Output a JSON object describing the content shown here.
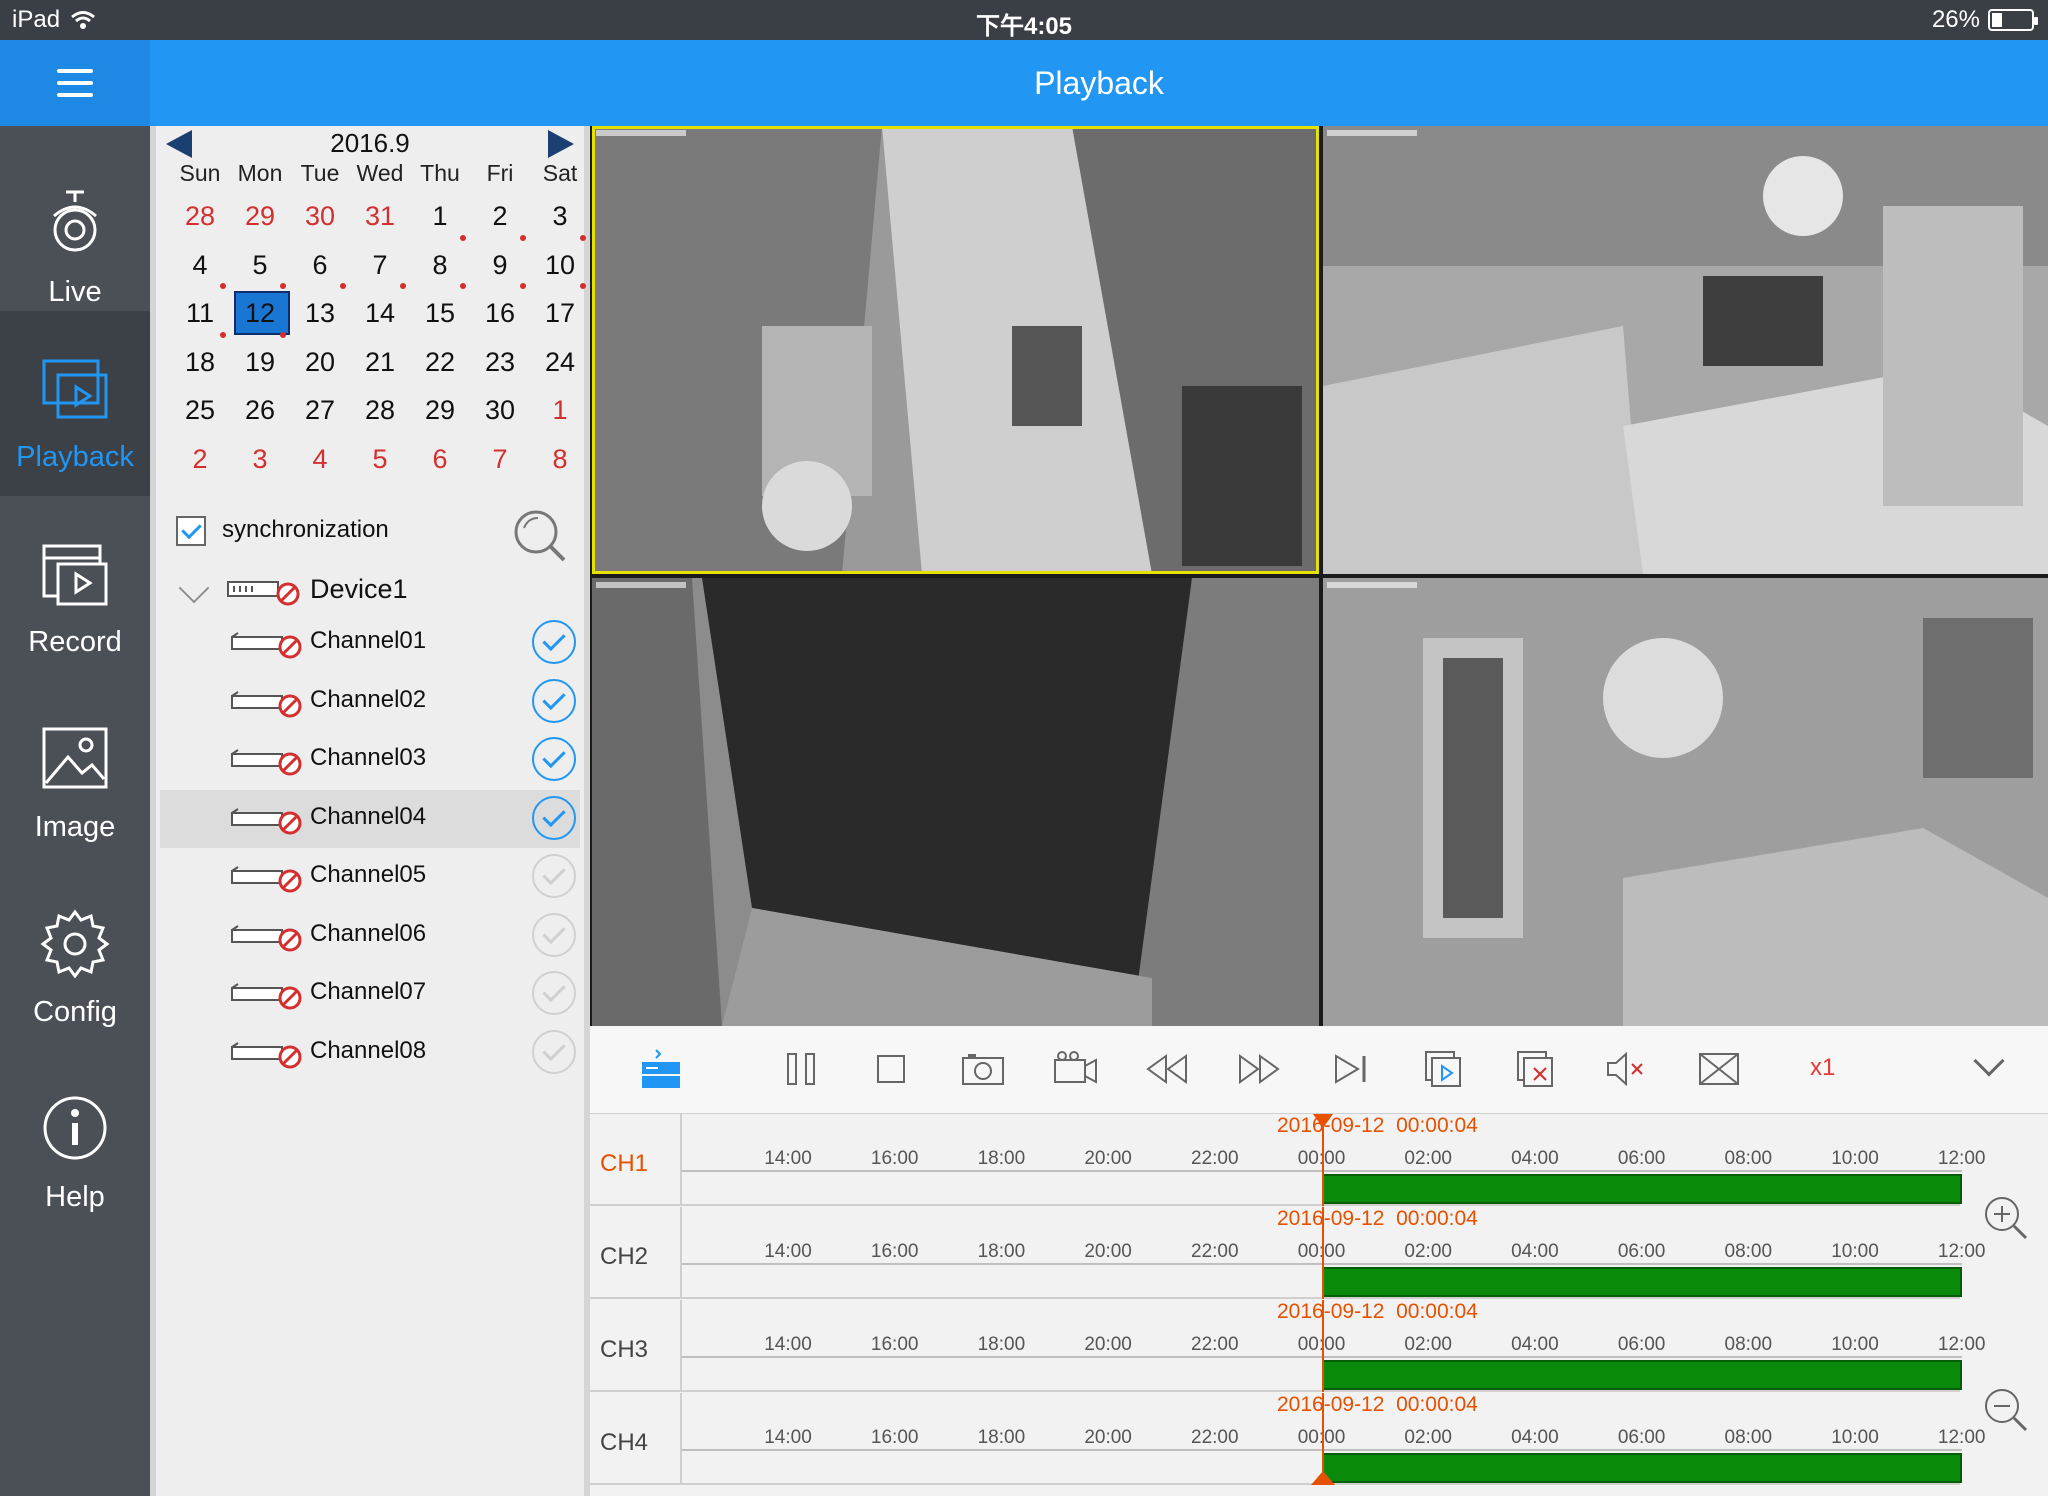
{
  "status_bar": {
    "device": "iPad",
    "time": "下午4:05",
    "battery": "26%",
    "battery_level": 0.26
  },
  "header": {
    "title": "Playback"
  },
  "nav": [
    {
      "label": "Live",
      "icon": "camera-icon",
      "active": false
    },
    {
      "label": "Playback",
      "icon": "playback-icon",
      "active": true
    },
    {
      "label": "Record",
      "icon": "record-icon",
      "active": false
    },
    {
      "label": "Image",
      "icon": "image-icon",
      "active": false
    },
    {
      "label": "Config",
      "icon": "gear-icon",
      "active": false
    },
    {
      "label": "Help",
      "icon": "info-icon",
      "active": false
    }
  ],
  "calendar": {
    "month_label": "2016.9",
    "weekdays": [
      "Sun",
      "Mon",
      "Tue",
      "Wed",
      "Thu",
      "Fri",
      "Sat"
    ],
    "days": [
      {
        "d": "28",
        "other": true
      },
      {
        "d": "29",
        "other": true
      },
      {
        "d": "30",
        "other": true
      },
      {
        "d": "31",
        "other": true
      },
      {
        "d": "1",
        "dot": true
      },
      {
        "d": "2",
        "dot": true
      },
      {
        "d": "3",
        "dot": true
      },
      {
        "d": "4",
        "dot": true
      },
      {
        "d": "5",
        "dot": true
      },
      {
        "d": "6",
        "dot": true
      },
      {
        "d": "7",
        "dot": true
      },
      {
        "d": "8",
        "dot": true
      },
      {
        "d": "9",
        "dot": true
      },
      {
        "d": "10",
        "dot": true
      },
      {
        "d": "11",
        "dot": true
      },
      {
        "d": "12",
        "dot": true,
        "selected": true
      },
      {
        "d": "13"
      },
      {
        "d": "14"
      },
      {
        "d": "15"
      },
      {
        "d": "16"
      },
      {
        "d": "17"
      },
      {
        "d": "18"
      },
      {
        "d": "19"
      },
      {
        "d": "20"
      },
      {
        "d": "21"
      },
      {
        "d": "22"
      },
      {
        "d": "23"
      },
      {
        "d": "24"
      },
      {
        "d": "25"
      },
      {
        "d": "26"
      },
      {
        "d": "27"
      },
      {
        "d": "28"
      },
      {
        "d": "29"
      },
      {
        "d": "30"
      },
      {
        "d": "1",
        "other": true
      },
      {
        "d": "2",
        "other": true
      },
      {
        "d": "3",
        "other": true
      },
      {
        "d": "4",
        "other": true
      },
      {
        "d": "5",
        "other": true
      },
      {
        "d": "6",
        "other": true
      },
      {
        "d": "7",
        "other": true
      },
      {
        "d": "8",
        "other": true
      }
    ]
  },
  "sync": {
    "label": "synchronization",
    "checked": true
  },
  "device": {
    "label": "Device1"
  },
  "channels": [
    {
      "label": "Channel01",
      "checked": true
    },
    {
      "label": "Channel02",
      "checked": true
    },
    {
      "label": "Channel03",
      "checked": true
    },
    {
      "label": "Channel04",
      "checked": true,
      "highlight": true
    },
    {
      "label": "Channel05",
      "checked": false
    },
    {
      "label": "Channel06",
      "checked": false
    },
    {
      "label": "Channel07",
      "checked": false
    },
    {
      "label": "Channel08",
      "checked": false
    }
  ],
  "toolbar": {
    "speed": "x1"
  },
  "timeline": {
    "date": "2016-09-12",
    "time": "00:00:04",
    "ticks": [
      "14:00",
      "16:00",
      "18:00",
      "20:00",
      "22:00",
      "00:00",
      "02:00",
      "04:00",
      "06:00",
      "08:00",
      "10:00",
      "12:00"
    ],
    "rows": [
      {
        "label": "CH1",
        "active": true
      },
      {
        "label": "CH2",
        "active": false
      },
      {
        "label": "CH3",
        "active": false
      },
      {
        "label": "CH4",
        "active": false
      }
    ]
  },
  "colors": {
    "accent": "#2196f3",
    "header": "#2196f3",
    "record": "#0a8a0a",
    "cursor": "#e65100",
    "alert": "#d32f2f"
  }
}
